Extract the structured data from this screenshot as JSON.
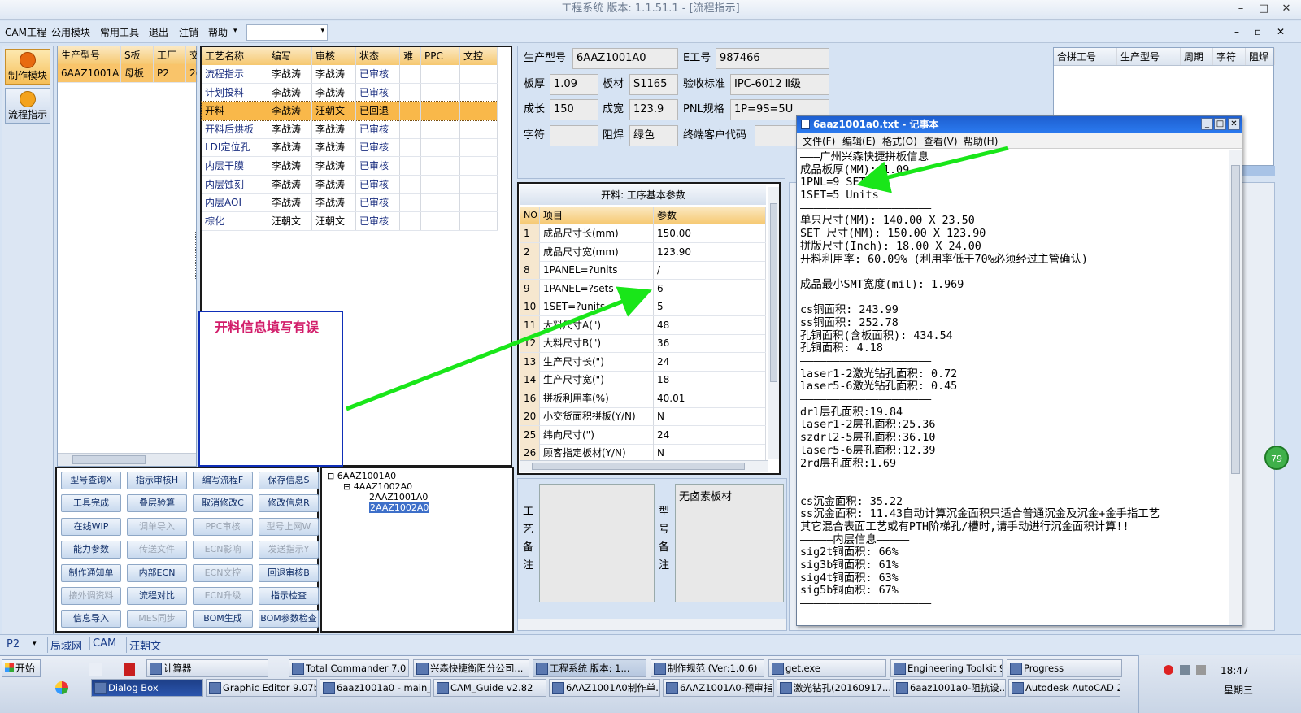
{
  "window": {
    "title": "工程系统   版本: 1.1.51.1 - [流程指示]"
  },
  "menu": {
    "items": [
      "CAM工程",
      "公用模块",
      "常用工具",
      "退出",
      "注销",
      "帮助"
    ],
    "dropdown_value": ""
  },
  "side": {
    "make_module": "制作模块",
    "flow": "流程指示"
  },
  "left_grid": {
    "headers": [
      "生产型号",
      "S板",
      "工厂",
      "交"
    ],
    "row": [
      "6AAZ1001A0",
      "母板",
      "P2",
      "2("
    ]
  },
  "process_grid": {
    "headers": [
      "工艺名称",
      "编写",
      "审核",
      "状态",
      "难",
      "PPC",
      "文控"
    ],
    "rows": [
      [
        "流程指示",
        "李战涛",
        "李战涛",
        "已审核"
      ],
      [
        "计划投料",
        "李战涛",
        "李战涛",
        "已审核"
      ],
      [
        "开料",
        "李战涛",
        "汪朝文",
        "已回退"
      ],
      [
        "开料后烘板",
        "李战涛",
        "李战涛",
        "已审核"
      ],
      [
        "LDI定位孔",
        "李战涛",
        "李战涛",
        "已审核"
      ],
      [
        "内层干膜",
        "李战涛",
        "李战涛",
        "已审核"
      ],
      [
        "内层蚀刻",
        "李战涛",
        "李战涛",
        "已审核"
      ],
      [
        "内层AOI",
        "李战涛",
        "李战涛",
        "已审核"
      ],
      [
        "棕化",
        "汪朝文",
        "汪朝文",
        "已审核"
      ]
    ]
  },
  "annotation": {
    "text": "开料信息填写有误"
  },
  "buttons": [
    [
      "型号查询X",
      "指示审核H",
      "编写流程F",
      "保存信息S"
    ],
    [
      "工具完成",
      "叠层验算",
      "取消修改C",
      "修改信息R"
    ],
    [
      "在线WIP",
      "调单导入",
      "PPC审核",
      "型号上网W"
    ],
    [
      "能力参数",
      "传送文件",
      "ECN影响",
      "发送指示Y"
    ],
    [
      "制作通知单",
      "内部ECN",
      "ECN文控",
      "回退审核B"
    ],
    [
      "接外调资料",
      "流程对比",
      "ECN升级",
      "指示检查"
    ],
    [
      "信息导入",
      "MES同步",
      "BOM生成",
      "BOM参数检查"
    ]
  ],
  "tree": {
    "nodes": [
      "6AAZ1001A0",
      "4AAZ1002A0",
      "2AAZ1001A0",
      "2AAZ1002A0"
    ]
  },
  "info": {
    "model_label": "生产型号",
    "model": "6AAZ1001A0",
    "e_label": "E工号",
    "e": "987466",
    "thick_label": "板厚",
    "thick": "1.09",
    "mat_label": "板材",
    "mat": "S1165",
    "std_label": "验收标准",
    "std": "IPC-6012 Ⅱ级",
    "len_label": "成长",
    "len": "150",
    "wid_label": "成宽",
    "wid": "123.9",
    "pnl_label": "PNL规格",
    "pnl": "1P=9S=5U",
    "char_label": "字符",
    "char": "",
    "mask_label": "阻焊",
    "mask": "绿色",
    "cust_label": "终端客户代码"
  },
  "right_grid": {
    "headers": [
      "合拼工号",
      "生产型号",
      "周期",
      "字符",
      "阻焊"
    ]
  },
  "params": {
    "title": "开料: 工序基本参数",
    "headers": [
      "NO",
      "项目",
      "参数"
    ],
    "rows": [
      [
        "1",
        "成品尺寸长(mm)",
        "150.00"
      ],
      [
        "2",
        "成品尺寸宽(mm)",
        "123.90"
      ],
      [
        "8",
        "1PANEL=?units",
        "/"
      ],
      [
        "9",
        "1PANEL=?sets",
        "6"
      ],
      [
        "10",
        "1SET=?units",
        "5"
      ],
      [
        "11",
        "大料尺寸A(\")",
        "48"
      ],
      [
        "12",
        "大料尺寸B(\")",
        "36"
      ],
      [
        "13",
        "生产尺寸长(\")",
        "24"
      ],
      [
        "14",
        "生产尺寸宽(\")",
        "18"
      ],
      [
        "16",
        "拼板利用率(%)",
        "40.01"
      ],
      [
        "20",
        "小交货面积拼板(Y/N)",
        "N"
      ],
      [
        "25",
        "纬向尺寸(\")",
        "24"
      ],
      [
        "26",
        "顾客指定板材(Y/N)",
        "N"
      ]
    ]
  },
  "remarks": {
    "proc_label": "工艺备注",
    "model_label": "型号备注",
    "model_value": "无卤素板材"
  },
  "notepad": {
    "title": "6aaz1001a0.txt - 记事本",
    "menu": [
      "文件(F)",
      "编辑(E)",
      "格式(O)",
      "查看(V)",
      "帮助(H)"
    ],
    "lines": [
      "———广州兴森快捷拼板信息",
      "成品板厚(MM): 1.09",
      "1PNL=9 SET",
      "1SET=5 Units",
      "————————————————————",
      "单只尺寸(MM): 140.00 X 23.50",
      "SET 尺寸(MM): 150.00 X 123.90",
      "拼版尺寸(Inch): 18.00 X 24.00",
      "开料利用率: 60.09% (利用率低于70%必须经过主管确认)",
      "————————————————————",
      "成品最小SMT宽度(mil): 1.969",
      "————————————————————",
      "cs铜面积: 243.99",
      "ss铜面积: 252.78",
      "孔铜面积(含板面积): 434.54",
      "孔铜面积: 4.18",
      "————————————————————",
      "laser1-2激光钻孔面积: 0.72",
      "laser5-6激光钻孔面积: 0.45",
      "————————————————————",
      "drl层孔面积:19.84",
      "laser1-2层孔面积:25.36",
      "szdrl2-5层孔面积:36.10",
      "laser5-6层孔面积:12.39",
      "2rd层孔面积:1.69",
      "————————————————————",
      "",
      "cs沉金面积: 35.22",
      "ss沉金面积: 11.43自动计算沉金面积只适合普通沉金及沉金+金手指工艺",
      "其它混合表面工艺或有PTH阶梯孔/槽时,请手动进行沉金面积计算!!",
      "—————内层信息—————",
      "sig2t铜面积: 66%",
      "sig3b铜面积: 61%",
      "sig4t铜面积: 63%",
      "sig5b铜面积: 67%",
      "————————————————————"
    ]
  },
  "statusbar": {
    "factory": "P2",
    "net": "局域网",
    "cam": "CAM",
    "user": "汪朝文"
  },
  "badge": "79",
  "taskbar": {
    "start": "开始",
    "row1": [
      "计算器",
      "Total Commander 7.0 ...",
      "兴森快捷衡阳分公司...",
      "工程系统  版本: 1...",
      "制作规范 (Ver:1.0.6)",
      "get.exe",
      "Engineering Toolkit 9....",
      "Progress"
    ],
    "row2": [
      "Dialog Box",
      "Graphic Editor 9.07b...",
      "6aaz1001a0 - main_qa",
      "CAM_Guide v2.82",
      "6AAZ1001A0制作单....",
      "6AAZ1001A0-预审指...",
      "激光钻孔(20160917...",
      "6aaz1001a0-阻抗设...",
      "Autodesk AutoCAD 2..."
    ],
    "time": "18:47",
    "day": "星期三"
  },
  "colors": {
    "accent": "#f6c870",
    "selected": "#f7b24a",
    "arrow": "#19e619",
    "annot": "#d21d6a",
    "frame": "#0f2fb8"
  }
}
